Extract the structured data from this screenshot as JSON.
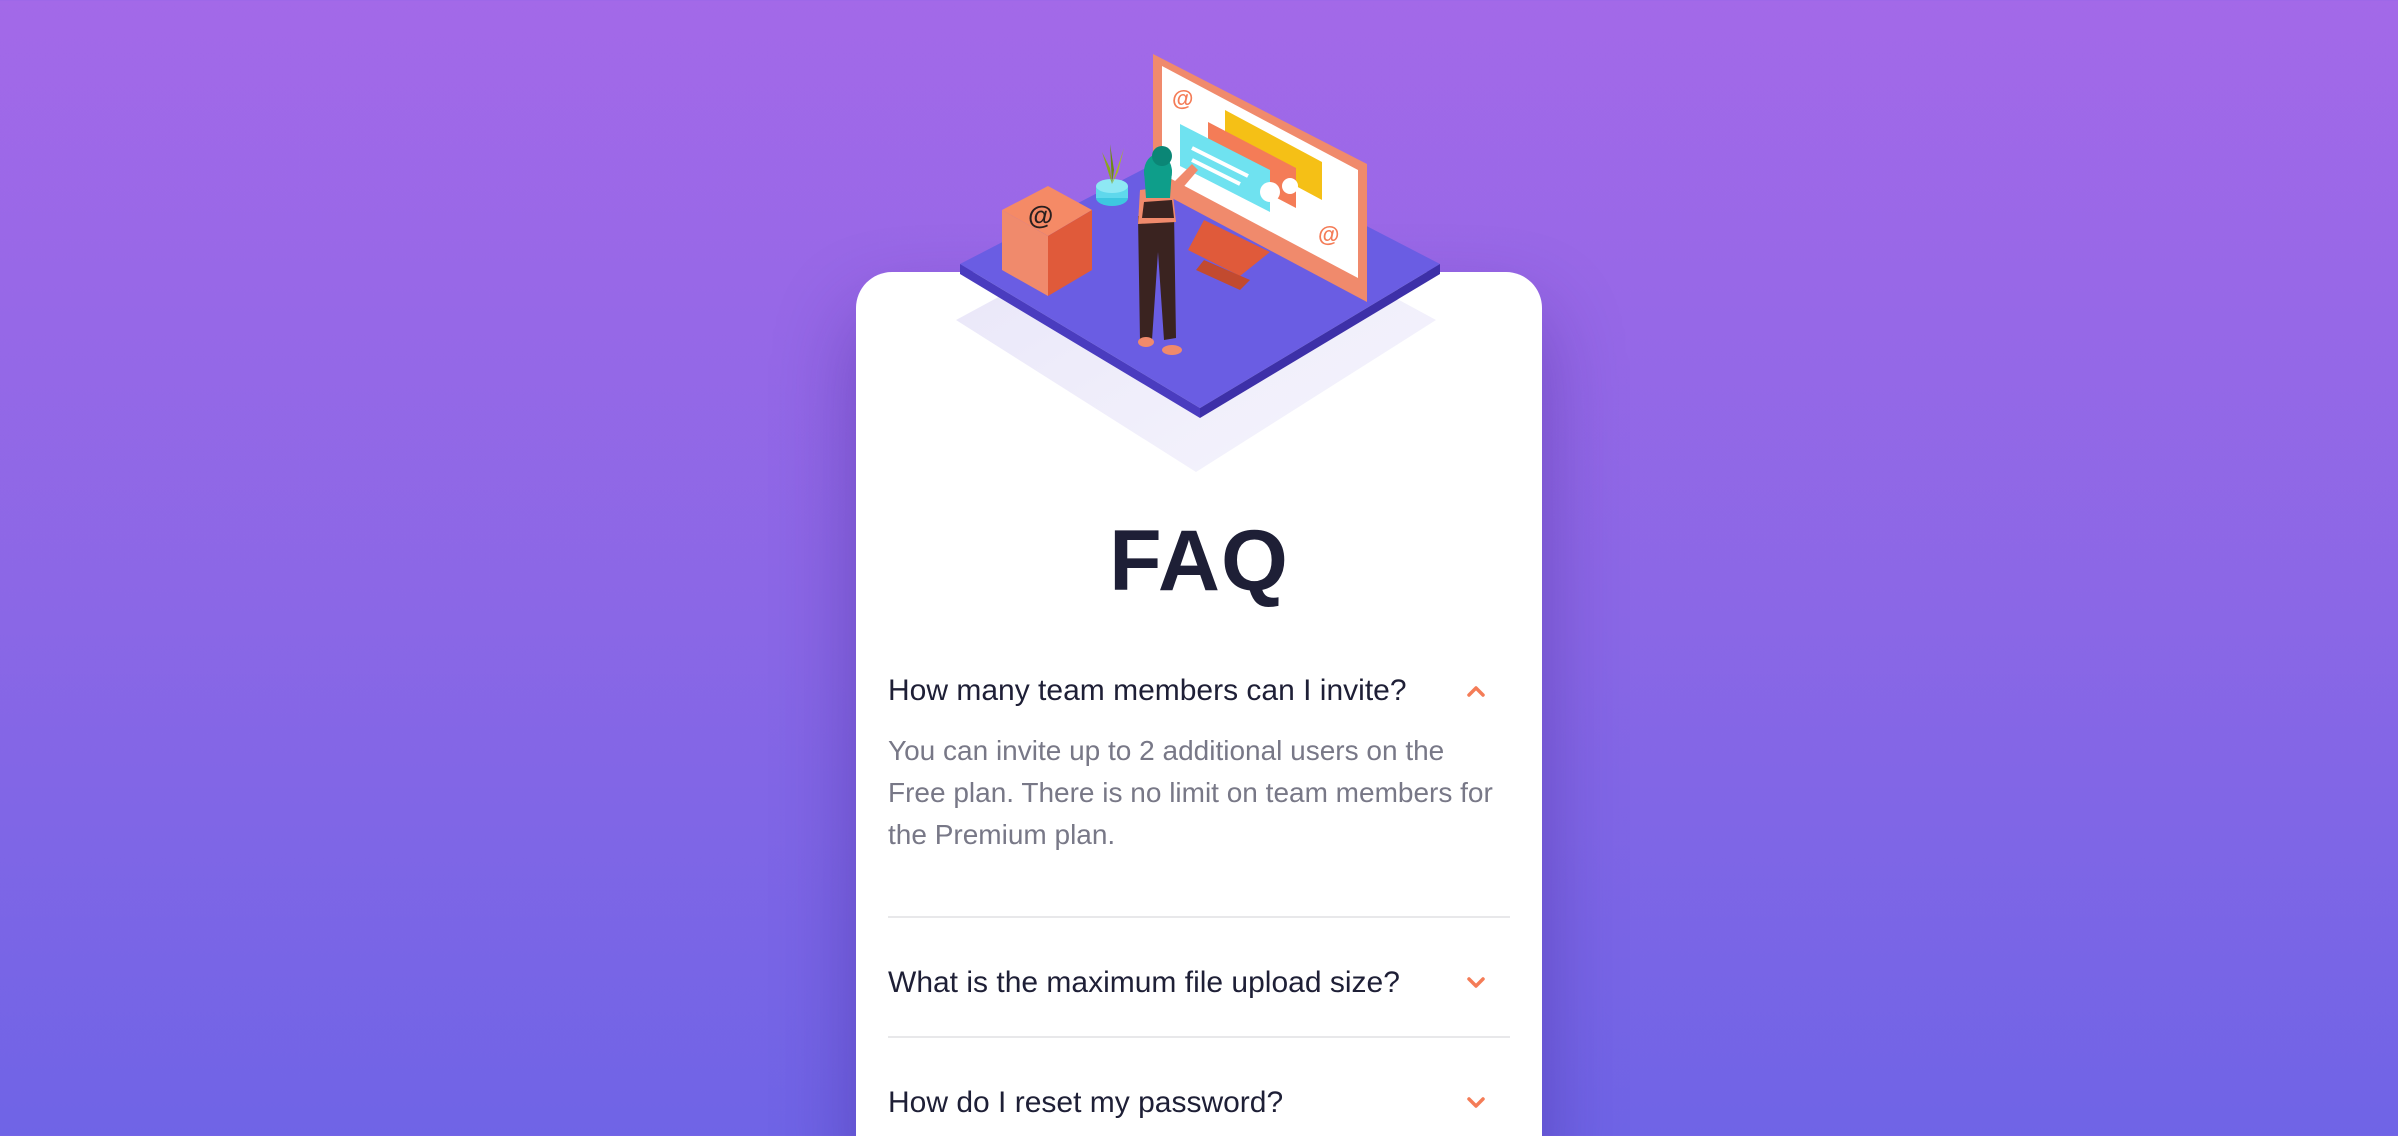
{
  "page": {
    "title": "FAQ"
  },
  "faq": [
    {
      "question": "How many team members can I invite?",
      "answer": "You can invite up to 2 additional users on the Free plan. There is no limit on team members for the Premium plan.",
      "expanded": true,
      "icon": "chevron-up-icon"
    },
    {
      "question": "What is the maximum file upload size?",
      "expanded": false,
      "icon": "chevron-down-icon"
    },
    {
      "question": "How do I reset my password?",
      "expanded": false,
      "icon": "chevron-down-icon"
    }
  ],
  "colors": {
    "background_top": "#a369e8",
    "background_bottom": "#6f64e6",
    "heading": "#1e1f36",
    "answer_text": "#787887",
    "accent": "#f47c57",
    "divider": "#e8e8ea"
  }
}
